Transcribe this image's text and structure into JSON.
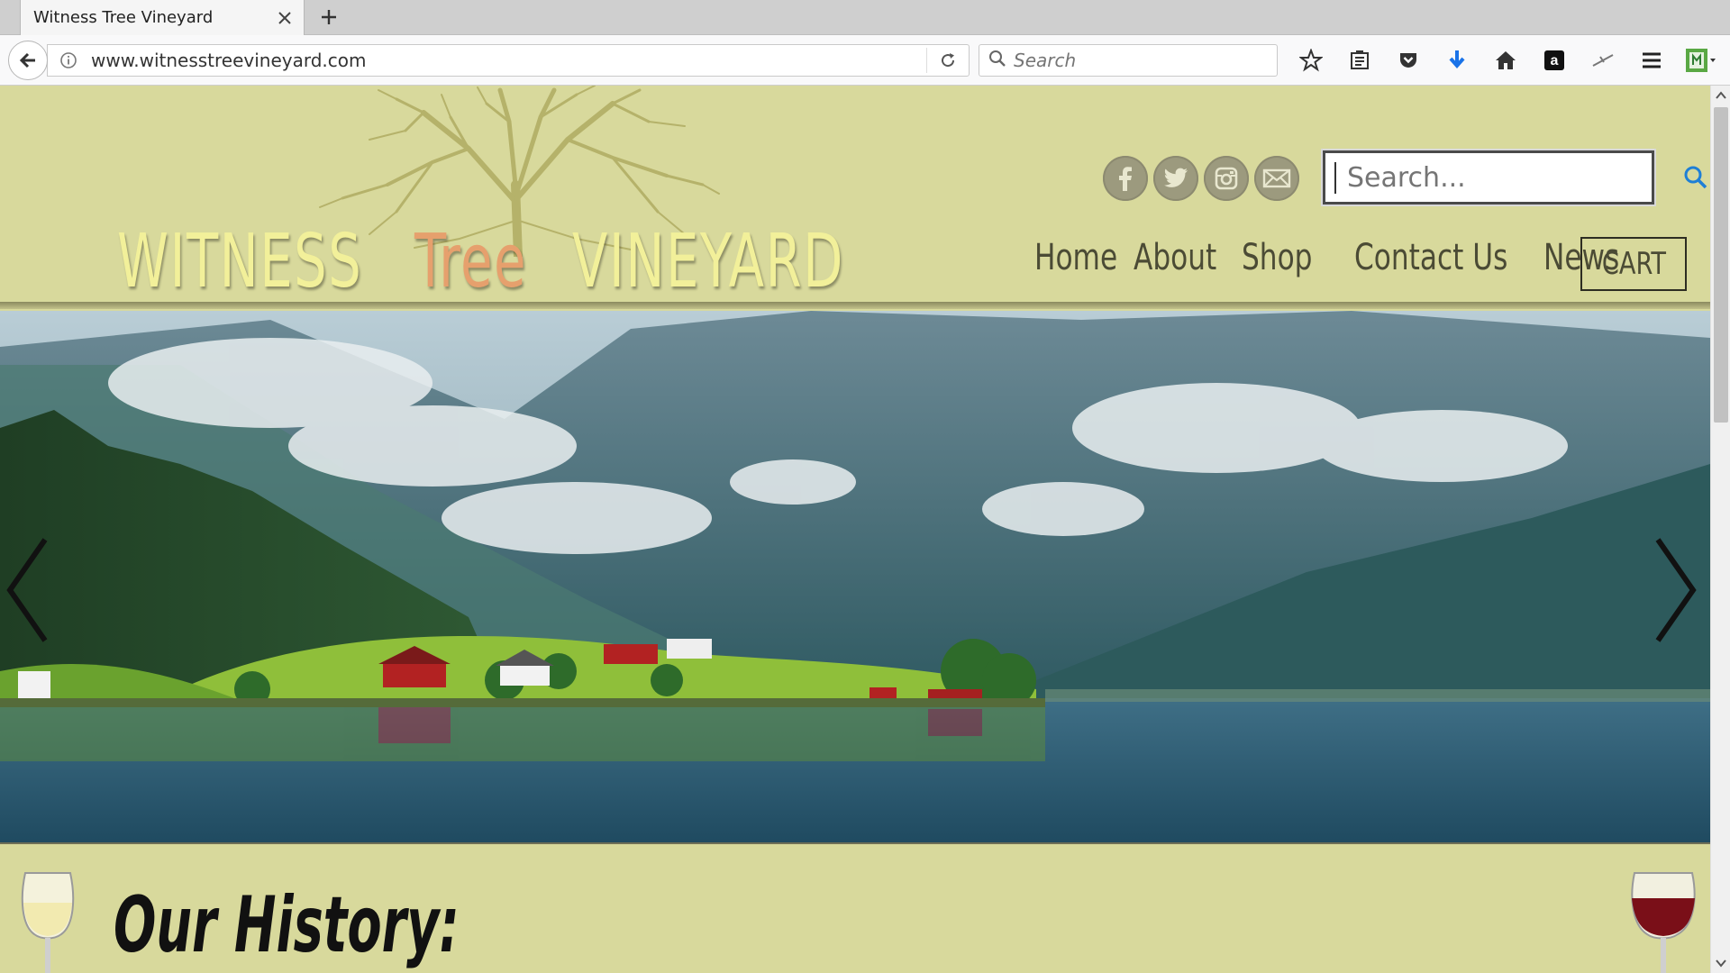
{
  "browser": {
    "tab_title": "Witness Tree Vineyard",
    "url": "www.witnesstreevineyard.com",
    "search_placeholder": "Search"
  },
  "header": {
    "brand": {
      "part1": "WITNESS",
      "part2": "Tree",
      "part3": "VINEYARD"
    },
    "search_placeholder": "Search...",
    "social": [
      "facebook-icon",
      "twitter-icon",
      "instagram-icon",
      "email-icon"
    ],
    "nav": [
      {
        "label": "Home"
      },
      {
        "label": "About"
      },
      {
        "label": "Shop"
      },
      {
        "label": "Contact Us"
      },
      {
        "label": "News"
      }
    ],
    "cart_label": "CART"
  },
  "section": {
    "title": "Our History:"
  },
  "colors": {
    "page_bg": "#d8d99c",
    "brand_text": "#f2f09a",
    "brand_accent": "#e6a06d",
    "nav_text": "#4b4b35"
  }
}
